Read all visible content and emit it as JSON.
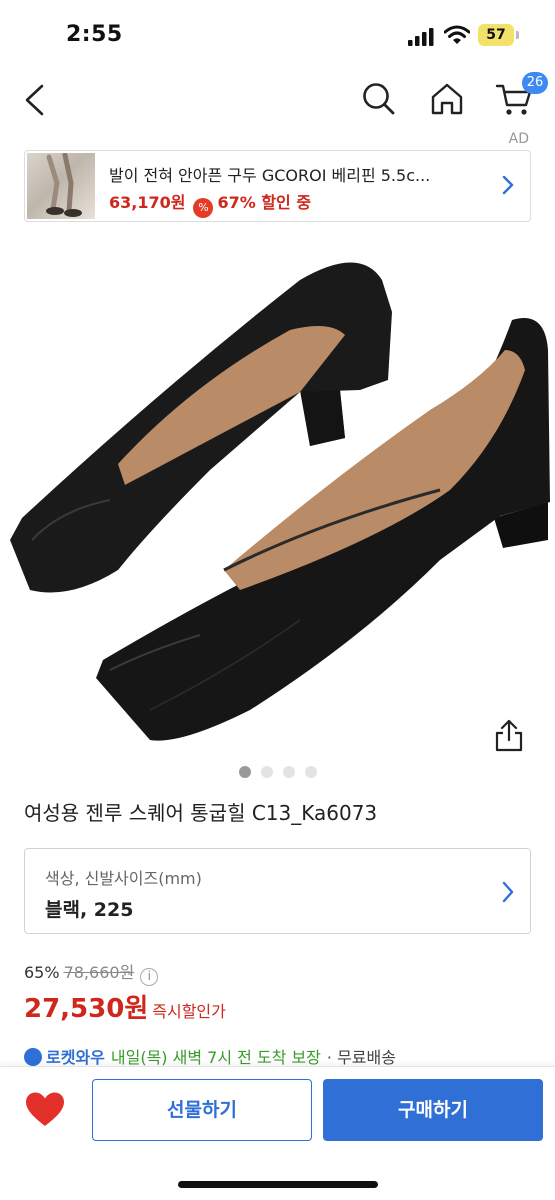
{
  "status_bar": {
    "time": "2:55",
    "battery": "57",
    "battery_color": "#f2e16a"
  },
  "header": {
    "back_icon": "chevron-left-icon",
    "search_icon": "search-icon",
    "home_icon": "home-icon",
    "cart_icon": "cart-icon",
    "cart_count": "26",
    "ad_label": "AD"
  },
  "ad_banner": {
    "title": "발이 전혀 안아픈 구두 GCOROI 베리핀 5.5c...",
    "price": "63,170원",
    "discount_badge": "%",
    "discount_text": "67% 할인 중"
  },
  "gallery": {
    "page_count": 4,
    "active_index": 0,
    "share_icon": "share-icon"
  },
  "product": {
    "title": "여성용 젠루 스퀘어 통굽힐 C13_Ka6073",
    "option_label": "색상, 신발사이즈(mm)",
    "option_value": "블랙, 225",
    "discount_rate": "65%",
    "original_price": "78,660원",
    "info_icon": "i",
    "final_price": "27,530원",
    "instant_discount": "즉시할인가"
  },
  "delivery": {
    "rocket_label": "로켓와우",
    "arrival": "내일(목) 새벽 7시 전 도착 보장",
    "shipping": "· 무료배송"
  },
  "bottom_bar": {
    "heart_icon": "heart-icon",
    "gift_button": "선물하기",
    "buy_button": "구매하기"
  },
  "colors": {
    "accent": "#2f6fd6",
    "price_red": "#d0271c",
    "heart_red": "#e3302b",
    "delivery_green": "#3a9b2c"
  }
}
